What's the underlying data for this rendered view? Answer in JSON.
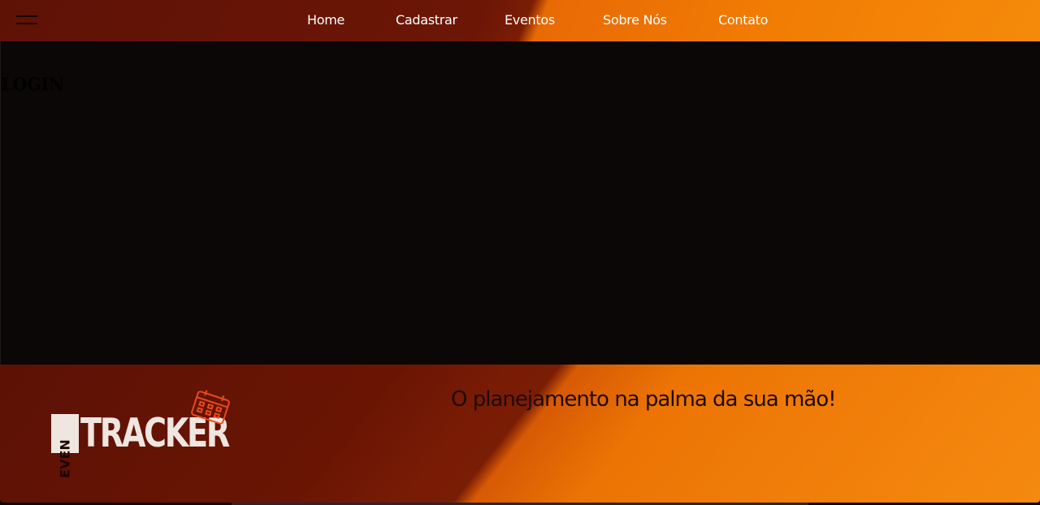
{
  "header": {
    "menu_icon": "hamburger-menu-icon",
    "nav": [
      {
        "label": "Home"
      },
      {
        "label": "Cadastrar"
      },
      {
        "label": "Eventos"
      },
      {
        "label": "Sobre Nós"
      },
      {
        "label": "Contato"
      }
    ]
  },
  "main": {
    "title": "LOGIN"
  },
  "footer": {
    "logo": {
      "small_word": "EVEN",
      "big_word": "TRACKER",
      "icon": "calendar-icon"
    },
    "slogan": "O planejamento na palma da sua mão!"
  },
  "colors": {
    "header_dark": "#6c1606",
    "header_orange": "#f27d04",
    "main_bg": "#0b0707",
    "logo_text": "#efe6df",
    "calendar_icon": "#e84a1c"
  }
}
